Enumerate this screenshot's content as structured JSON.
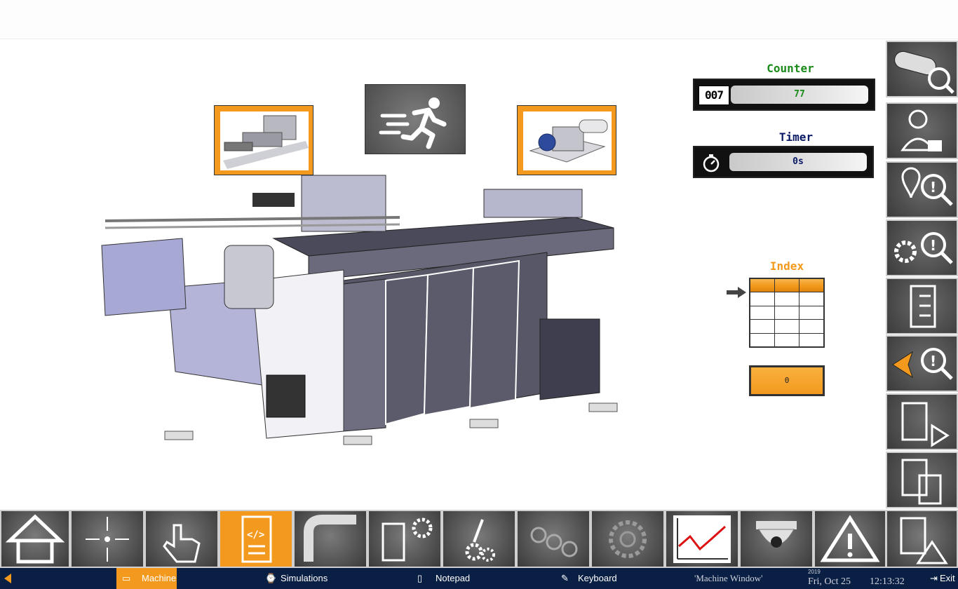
{
  "counter": {
    "title": "Counter",
    "value": "77",
    "odometer": "007"
  },
  "timer": {
    "title": "Timer",
    "value": "0s"
  },
  "index": {
    "title": "Index",
    "button_label": "0"
  },
  "taskbar": {
    "machine": "Machine",
    "simulations": "Simulations",
    "notepad": "Notepad",
    "keyboard": "Keyboard",
    "window_title": "'Machine Window'",
    "year": "2019",
    "date": "Fri,  Oct 25",
    "time": "12:13:32",
    "exit": "Exit"
  },
  "colors": {
    "accent": "#f39a1e",
    "counter_title": "#1a8a1a",
    "timer_title": "#0b1a66",
    "taskbar": "#0a1f44"
  },
  "icons": {
    "sidebar": [
      "pipe-search-icon",
      "user-lock-icon",
      "home-location-search-icon",
      "settings-search-icon",
      "checklist-icon",
      "back-arrow-search-icon",
      "clipboard-play-icon",
      "clipboard-copy-icon",
      "clipboard-warning-icon"
    ],
    "toolbar": [
      "home-icon",
      "center-arrows-icon",
      "hand-pointer-icon",
      "code-document-icon",
      "bend-pipe-icon",
      "die-settings-icon",
      "robot-arm-settings-icon",
      "rollers-icon",
      "gear-icon",
      "chart-trend-icon",
      "camera-icon",
      "warning-icon"
    ]
  }
}
